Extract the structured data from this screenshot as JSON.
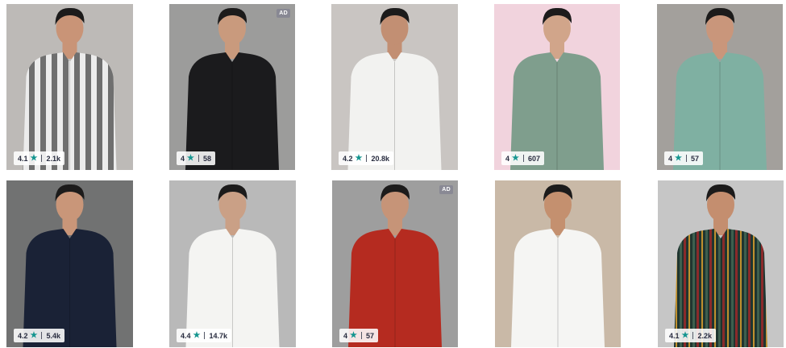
{
  "products": [
    {
      "rating": "4.1",
      "count": "2.1k",
      "ad": false,
      "bg": "#bdbab7",
      "shirt": "striped-grey",
      "shirt_color": "#d9d9d9",
      "skin": "#c99477"
    },
    {
      "rating": "4",
      "count": "58",
      "ad": true,
      "ad_label": "AD",
      "bg": "#9c9c9b",
      "shirt": "black",
      "shirt_color": "#1b1b1d",
      "skin": "#c99a7d"
    },
    {
      "rating": "4.2",
      "count": "20.8k",
      "ad": false,
      "bg": "#c9c5c2",
      "shirt": "white",
      "shirt_color": "#f2f2f0",
      "skin": "#c28f73"
    },
    {
      "rating": "4",
      "count": "607",
      "ad": false,
      "bg": "#f1d3dd",
      "shirt": "sage-green",
      "shirt_color": "#7f9e8d",
      "skin": "#d1a58a"
    },
    {
      "rating": "4",
      "count": "57",
      "ad": false,
      "bg": "#a3a09c",
      "shirt": "mint",
      "shirt_color": "#7fb0a2",
      "skin": "#c9967b"
    },
    {
      "rating": "4.2",
      "count": "5.4k",
      "ad": false,
      "bg": "#717272",
      "shirt": "navy",
      "shirt_color": "#1a2236",
      "skin": "#c99679"
    },
    {
      "rating": "4.4",
      "count": "14.7k",
      "ad": false,
      "bg": "#b9b9b9",
      "shirt": "white",
      "shirt_color": "#f4f4f2",
      "skin": "#caa086"
    },
    {
      "rating": "4",
      "count": "57",
      "ad": true,
      "ad_label": "AD",
      "bg": "#9e9e9e",
      "shirt": "red",
      "shirt_color": "#b52b20",
      "skin": "#c69478"
    },
    {
      "rating": "",
      "count": "",
      "ad": false,
      "bg": "#c9b9a7",
      "shirt": "white",
      "shirt_color": "#f5f5f3",
      "skin": "#c4906f"
    },
    {
      "rating": "4.1",
      "count": "2.2k",
      "ad": false,
      "bg": "#c6c6c6",
      "shirt": "striped-multi",
      "shirt_color": "#2a3f3a",
      "skin": "#c48e6f"
    }
  ],
  "icons": {
    "star": "star-icon"
  }
}
